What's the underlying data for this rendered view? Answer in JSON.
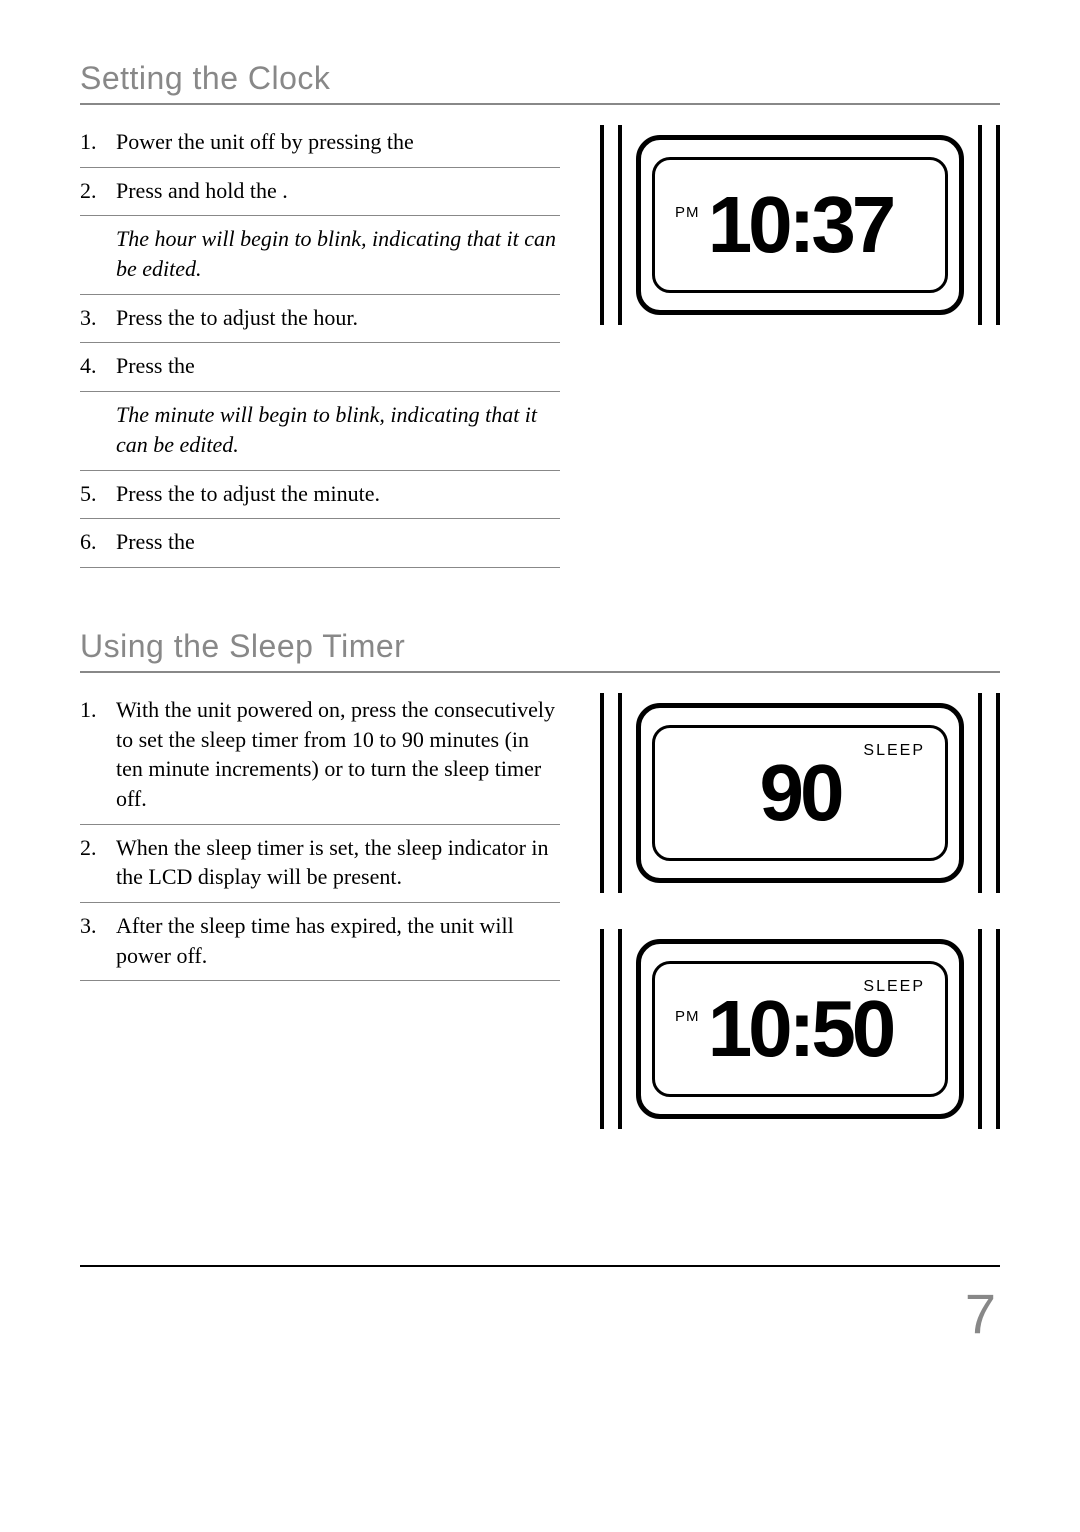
{
  "section1": {
    "title": "Setting the Clock",
    "steps": [
      {
        "num": "1.",
        "text": "Power the unit off by pressing the"
      },
      {
        "num": "2.",
        "text": "Press and hold the                                 ."
      },
      {
        "note": "The hour will begin to blink, indicating that it can be edited."
      },
      {
        "num": "3.",
        "text": "Press the                                      to adjust the hour."
      },
      {
        "num": "4.",
        "text": "Press the"
      },
      {
        "note": "The minute will begin to blink, indicating that it can be edited."
      },
      {
        "num": "5.",
        "text": "Press the                                      to adjust the minute."
      },
      {
        "num": "6.",
        "text": "Press the"
      }
    ],
    "lcd": {
      "pm": "PM",
      "value": "10:37"
    }
  },
  "section2": {
    "title": "Using the Sleep Timer",
    "steps": [
      {
        "num": "1.",
        "text": "With the unit powered on, press the                                consecutively to set the sleep timer from 10 to 90 minutes (in ten minute increments) or to turn the sleep timer off."
      },
      {
        "num": "2.",
        "text": "When the sleep timer is set, the sleep indicator in the LCD display will be present."
      },
      {
        "num": "3.",
        "text": "After the sleep time has expired, the unit will power off."
      }
    ],
    "lcd1": {
      "sleep": "SLEEP",
      "value": "90"
    },
    "lcd2": {
      "pm": "PM",
      "sleep": "SLEEP",
      "value": "10:50"
    }
  },
  "page_number": "7"
}
